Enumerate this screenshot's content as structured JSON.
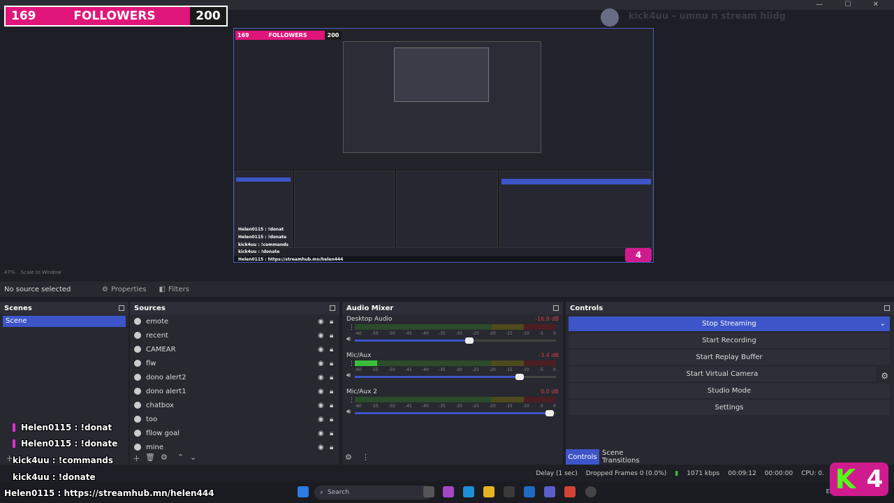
{
  "window": {
    "controls": "—  ☐  ✕"
  },
  "follower_goal": {
    "current": "169",
    "label": "FOLLOWERS",
    "target": "200"
  },
  "nested_preview": {
    "chat": [
      "Helen0115 : !donat",
      "Helen0115 : !donate",
      "kick4uu : !commands",
      "kick4uu : !donate"
    ],
    "url_line": "Helen0115 : https://streamhub.mn/helen444",
    "badge": "4"
  },
  "ghost_chat": "kick4uu – umnu n stream hiidg",
  "zoom": {
    "percent": "47%",
    "scale": "Scale to Window"
  },
  "context": {
    "no_source": "No source selected",
    "properties": "Properties",
    "filters": "Filters"
  },
  "scenes": {
    "title": "Scenes",
    "items": [
      "Scene"
    ]
  },
  "sources": {
    "title": "Sources",
    "items": [
      "emote",
      "recent",
      "CAMEAR",
      "flw",
      "dono alert2",
      "dono alert1",
      "chatbox",
      "too",
      "fllow goal",
      "mine"
    ]
  },
  "mixer": {
    "title": "Audio Mixer",
    "channels": [
      {
        "name": "Desktop Audio",
        "db": "-16.9 dB",
        "level": 0.0,
        "fader": 0.57
      },
      {
        "name": "Mic/Aux",
        "db": "-3.4 dB",
        "level": 0.11,
        "fader": 0.82
      },
      {
        "name": "Mic/Aux 2",
        "db": "0.0 dB",
        "level": 0.0,
        "fader": 0.97
      }
    ],
    "scale": [
      "-60",
      "-55",
      "-50",
      "-45",
      "-40",
      "-35",
      "-30",
      "-25",
      "-20",
      "-15",
      "-10",
      "-5",
      "0"
    ]
  },
  "controls": {
    "title": "Controls",
    "buttons": [
      "Stop Streaming",
      "Start Recording",
      "Start Replay Buffer",
      "Start Virtual Camera",
      "Studio Mode",
      "Settings"
    ]
  },
  "tabs": {
    "controls": "Controls",
    "transitions": "Scene Transitions"
  },
  "status": {
    "delay": "Delay (1 sec)",
    "dropped": "Dropped Frames 0 (0.0%)",
    "kbps": "1071 kbps",
    "stream_time": "00:09:12",
    "rec_time": "00:00:00",
    "cpu": "CPU: 0."
  },
  "chat": [
    {
      "text": "Helen0115 : !donat",
      "bar": true
    },
    {
      "text": "Helen0115 : !donate",
      "bar": true
    },
    {
      "text": "kick4uu : !commands",
      "bar": false
    },
    {
      "text": "kick4uu : !donate",
      "bar": false
    },
    {
      "text": "Helen0115 : https://streamhub.mn/helen444",
      "bar": false
    }
  ],
  "kick_badge": {
    "letter": "K",
    "count": "4"
  },
  "taskbar": {
    "search": "Search",
    "lang": "ENG"
  },
  "colors": {
    "accent": "#3d55c8",
    "pink": "#e0157a",
    "kick_green": "#53fc18"
  }
}
